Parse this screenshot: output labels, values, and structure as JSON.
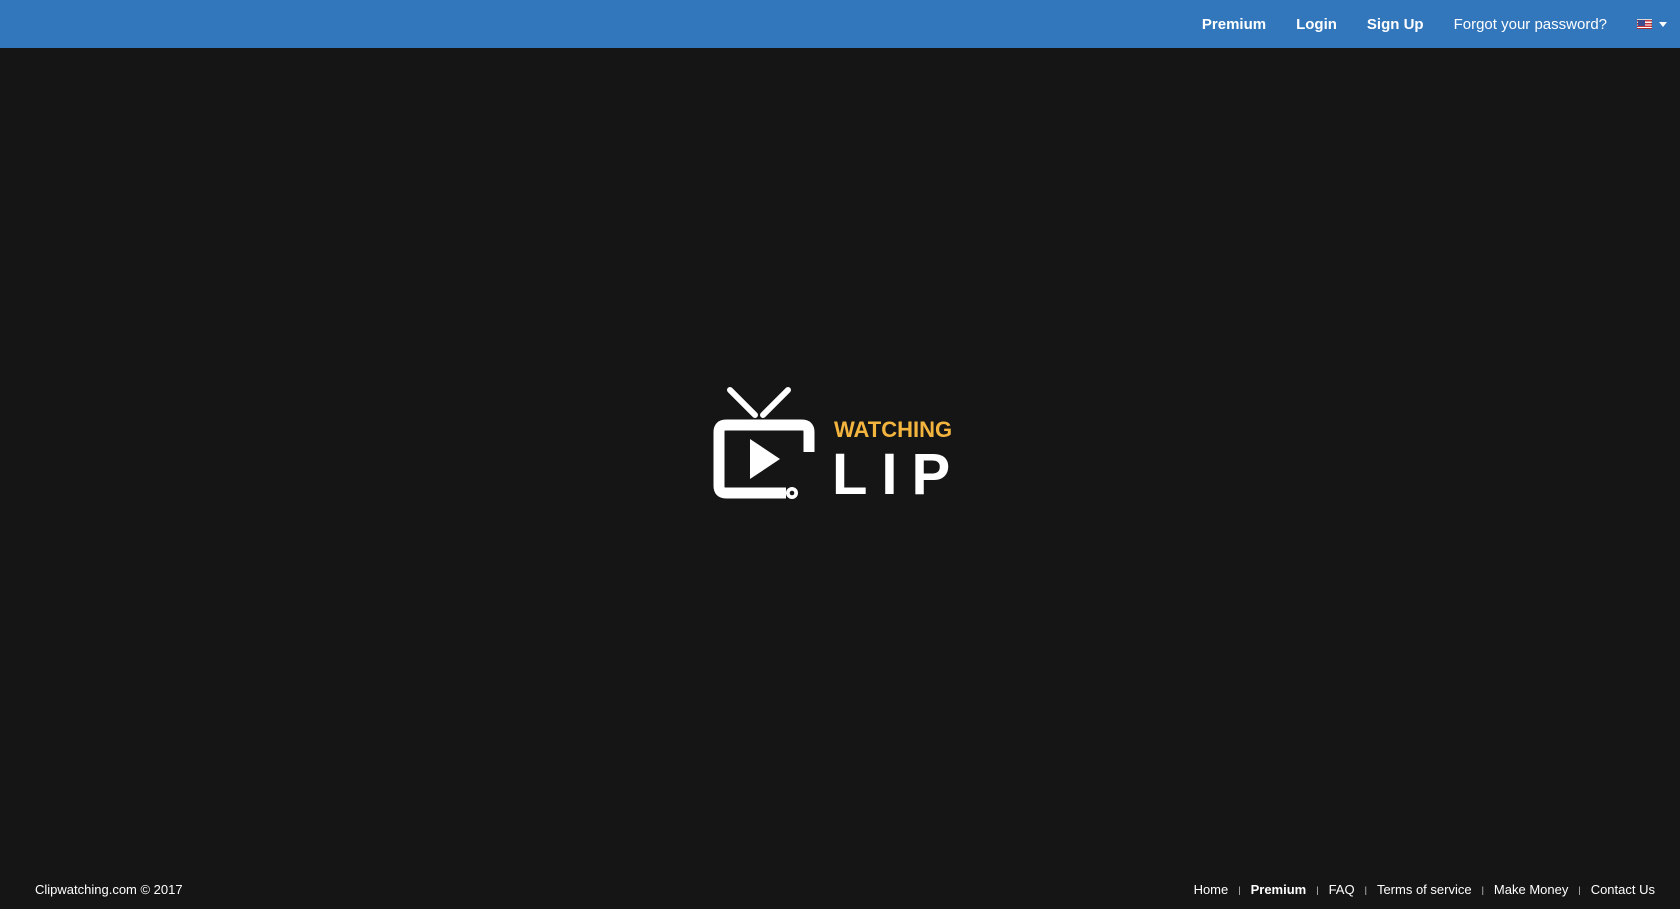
{
  "header": {
    "links": [
      "Premium",
      "Login",
      "Sign Up",
      "Forgot your password?"
    ],
    "language_icon": "us-flag-icon",
    "bg_color": "#3277bc"
  },
  "logo": {
    "top_text": "WATCHING",
    "bottom_text": "LIP",
    "accent_color": "#f4b53f",
    "icon": "tv-play-icon"
  },
  "footer": {
    "copyright": "Clipwatching.com © 2017",
    "links": [
      "Home",
      "Premium",
      "FAQ",
      "Terms of service",
      "Make Money",
      "Contact Us"
    ],
    "separator": "|"
  },
  "colors": {
    "background": "#151515",
    "text": "#ffffff"
  }
}
